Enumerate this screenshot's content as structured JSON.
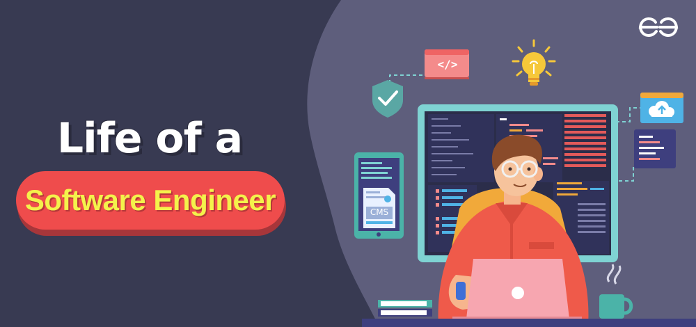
{
  "banner": {
    "title_line1": "Life of a",
    "title_line2": "Software Engineer",
    "code_tag": "</>",
    "cms_label": "CMS",
    "logo": "geeksforgeeks-logo"
  },
  "colors": {
    "background_left": "#383a52",
    "background_right": "#5d5d7b",
    "pill": "#ef4c4c",
    "pill_text": "#f4f24b",
    "monitor_frame": "#7fd3d3",
    "screen": "#2b2d4a",
    "shirt": "#ef5a4a",
    "laptop": "#f7a6b0"
  },
  "icons": [
    "shield-check-icon",
    "code-tag-icon",
    "lightbulb-icon",
    "cloud-upload-icon",
    "code-document-icon",
    "tablet-icon",
    "coffee-mug-icon",
    "books-icon",
    "laptop-icon"
  ]
}
